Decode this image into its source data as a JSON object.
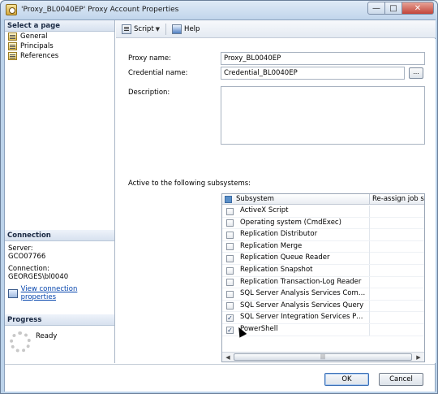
{
  "window": {
    "title": "'Proxy_BL0040EP' Proxy Account Properties"
  },
  "left": {
    "select_page_header": "Select a page",
    "pages": [
      {
        "label": "General",
        "icon": "page-icon"
      },
      {
        "label": "Principals",
        "icon": "page-icon"
      },
      {
        "label": "References",
        "icon": "page-icon"
      }
    ],
    "connection_header": "Connection",
    "server_label": "Server:",
    "server_value": "GCO07766",
    "connection_label": "Connection:",
    "connection_value": "GEORGES\\bl0040",
    "view_link": "View connection properties",
    "progress_header": "Progress",
    "progress_status": "Ready"
  },
  "toolbar": {
    "script_label": "Script",
    "help_label": "Help"
  },
  "form": {
    "proxy_name_label": "Proxy name:",
    "proxy_name_value": "Proxy_BL0040EP",
    "credential_label": "Credential name:",
    "credential_value": "Credential_BL0040EP",
    "browse_label": "...",
    "description_label": "Description:",
    "subsystems_label": "Active to the following subsystems:"
  },
  "grid": {
    "col_subsystem": "Subsystem",
    "col_reassign": "Re-assign job step",
    "rows": [
      {
        "name": "ActiveX Script",
        "checked": false
      },
      {
        "name": "Operating system (CmdExec)",
        "checked": false
      },
      {
        "name": "Replication Distributor",
        "checked": false
      },
      {
        "name": "Replication Merge",
        "checked": false
      },
      {
        "name": "Replication Queue Reader",
        "checked": false
      },
      {
        "name": "Replication Snapshot",
        "checked": false
      },
      {
        "name": "Replication Transaction-Log Reader",
        "checked": false
      },
      {
        "name": "SQL Server Analysis Services Command",
        "checked": false
      },
      {
        "name": "SQL Server Analysis Services Query",
        "checked": false
      },
      {
        "name": "SQL Server Integration Services Packa...",
        "checked": true
      },
      {
        "name": "PowerShell",
        "checked": true
      }
    ],
    "check_glyph": "✓"
  },
  "footer": {
    "ok_label": "OK",
    "cancel_label": "Cancel"
  }
}
